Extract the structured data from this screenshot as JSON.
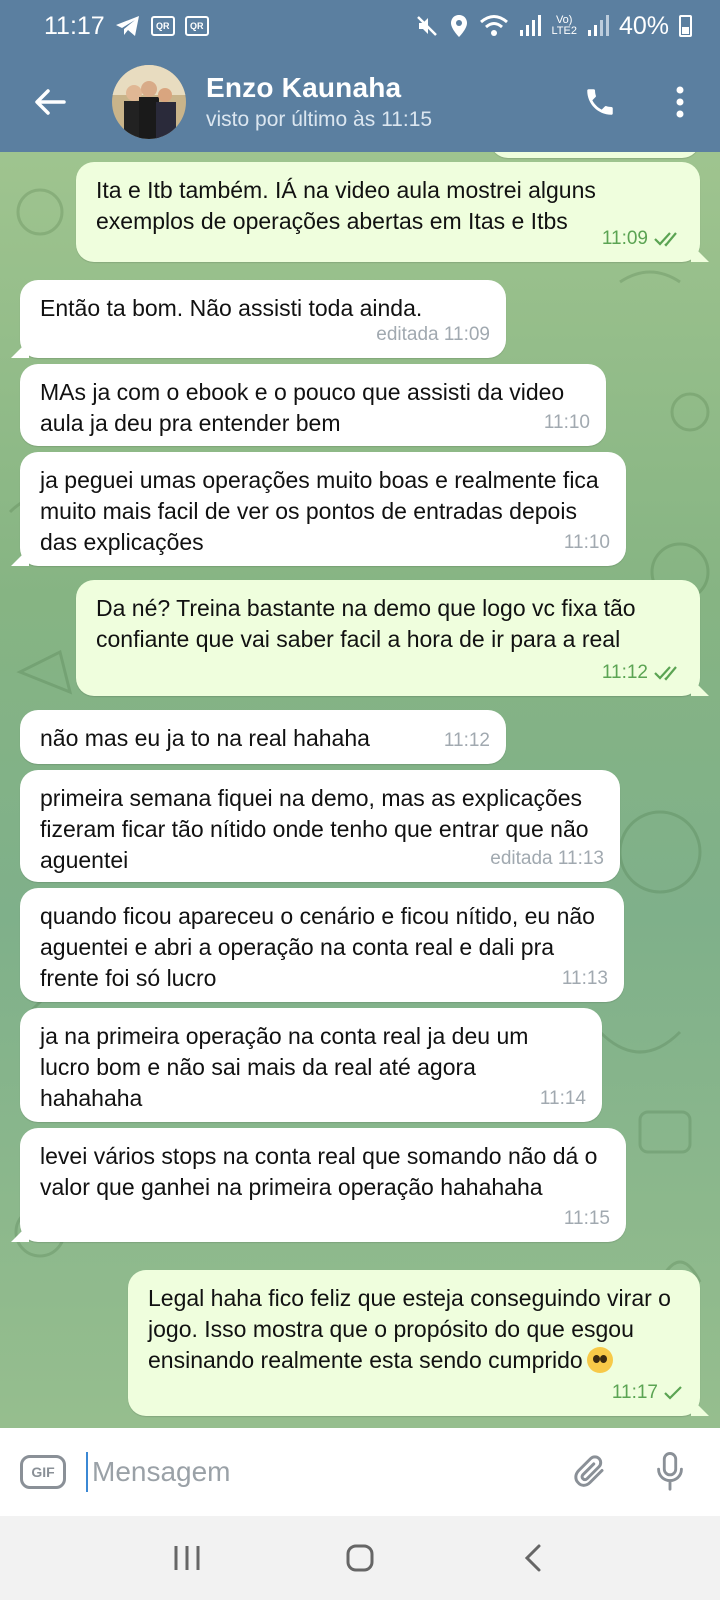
{
  "status_bar": {
    "time": "11:17",
    "battery": "40%",
    "network": "LTE2",
    "volte": "Vo)"
  },
  "header": {
    "contact_name": "Enzo Kaunaha",
    "last_seen": "visto por último às 11:15",
    "back_icon": "arrow-left-icon",
    "call_icon": "phone-icon",
    "menu_icon": "more-vertical-icon"
  },
  "messages": [
    {
      "dir": "out",
      "text": "Ita e Itb também. IÁ na video aula mostrei alguns exemplos de operações abertas em Itas e Itbs",
      "time": "11:09",
      "read": true
    },
    {
      "dir": "in",
      "text": "Então ta bom. Não assisti toda ainda.",
      "time": "editada 11:09"
    },
    {
      "dir": "in",
      "text": "MAs ja com o ebook e o pouco que assisti da video aula ja deu pra entender bem",
      "time": "11:10"
    },
    {
      "dir": "in",
      "text": "ja peguei umas operações muito boas e realmente fica muito mais facil de ver os pontos de entradas depois das explicações",
      "time": "11:10"
    },
    {
      "dir": "out",
      "text": "Da né? Treina bastante na demo que logo vc fixa tão confiante que vai saber facil a hora de ir para a real",
      "time": "11:12",
      "read": true
    },
    {
      "dir": "in",
      "text": "não mas eu ja to na real hahaha",
      "time": "11:12"
    },
    {
      "dir": "in",
      "text": "primeira semana fiquei na demo, mas as explicações fizeram ficar tão nítido onde tenho que entrar que não aguentei",
      "time": "editada 11:13"
    },
    {
      "dir": "in",
      "text": "quando ficou apareceu o cenário e ficou nítido, eu não aguentei e abri a operação na conta real e dali pra frente foi só lucro",
      "time": "11:13"
    },
    {
      "dir": "in",
      "text": "ja na primeira operação na conta real ja deu um lucro bom e não sai mais da real até agora hahahaha",
      "time": "11:14"
    },
    {
      "dir": "in",
      "text": "levei vários stops na conta real que somando não dá o valor que ganhei na primeira operação hahahaha",
      "time": "11:15"
    },
    {
      "dir": "out",
      "text": "Legal haha fico feliz que esteja conseguindo virar o jogo. Isso mostra que o propósito do que esgou ensinando realmente esta sendo cumprido",
      "time": "11:17",
      "read": false,
      "emoji": "pleading-face"
    }
  ],
  "input": {
    "gif_label": "GIF",
    "placeholder": "Mensagem",
    "attach_icon": "paperclip-icon",
    "mic_icon": "microphone-icon"
  },
  "nav": {
    "recents_icon": "recents-icon",
    "home_icon": "home-icon",
    "back_icon": "nav-back-icon"
  },
  "colors": {
    "header": "#5b7fa0",
    "outgoing_bubble": "#effedd",
    "incoming_bubble": "#ffffff",
    "read_check": "#5ba453"
  }
}
